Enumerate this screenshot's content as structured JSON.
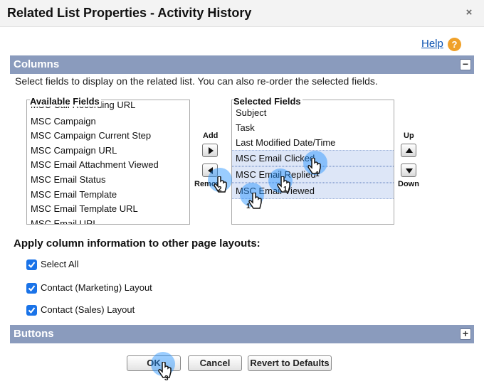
{
  "dialog": {
    "title": "Related List Properties - Activity History",
    "close_symbol": "×",
    "help_label": "Help",
    "help_icon_symbol": "?"
  },
  "columns_section": {
    "header": "Columns",
    "toggle_symbol": "−",
    "instructions": "Select fields to display on the related list. You can also re-order the selected fields.",
    "available_label": "Available Fields",
    "available_fields": [
      "MSC Call Recording URL",
      "MSC Campaign",
      "MSC Campaign Current Step",
      "MSC Campaign URL",
      "MSC Email Attachment Viewed",
      "MSC Email Status",
      "MSC Email Template",
      "MSC Email Template URL",
      "MSC Email URL"
    ],
    "selected_label": "Selected Fields",
    "selected_fields": [
      "Subject",
      "Task",
      "Last Modified Date/Time",
      "MSC Email Clicked",
      "MSC Email Replied",
      "MSC Email Viewed"
    ],
    "add_label": "Add",
    "remove_label": "Remove",
    "up_label": "Up",
    "down_label": "Down"
  },
  "layout_options": {
    "heading": "Apply column information to other page layouts:",
    "checkboxes": [
      {
        "label": "Select All",
        "checked": true
      },
      {
        "label": "Contact (Marketing) Layout",
        "checked": true
      },
      {
        "label": "Contact (Sales) Layout",
        "checked": true
      }
    ]
  },
  "buttons_section": {
    "header": "Buttons",
    "toggle_symbol": "+"
  },
  "footer": {
    "ok_label": "OK",
    "cancel_label": "Cancel",
    "revert_label": "Revert to Defaults"
  },
  "click_markers": [
    "1",
    "1",
    "1",
    "2",
    "3"
  ],
  "colors": {
    "section_bar": "#8a9bbd",
    "selection": "#dde6f7",
    "link": "#0b52b0",
    "help_icon": "#f0a12a",
    "checkbox": "#1a73e8",
    "click_glow": "#1e90ff"
  },
  "icons": {
    "close": "close-icon",
    "help": "help-icon",
    "add": "arrow-right-icon",
    "remove": "arrow-left-icon",
    "up": "arrow-up-icon",
    "down": "arrow-down-icon",
    "checkbox": "checkmark-icon",
    "cursor": "hand-pointer-icon"
  }
}
